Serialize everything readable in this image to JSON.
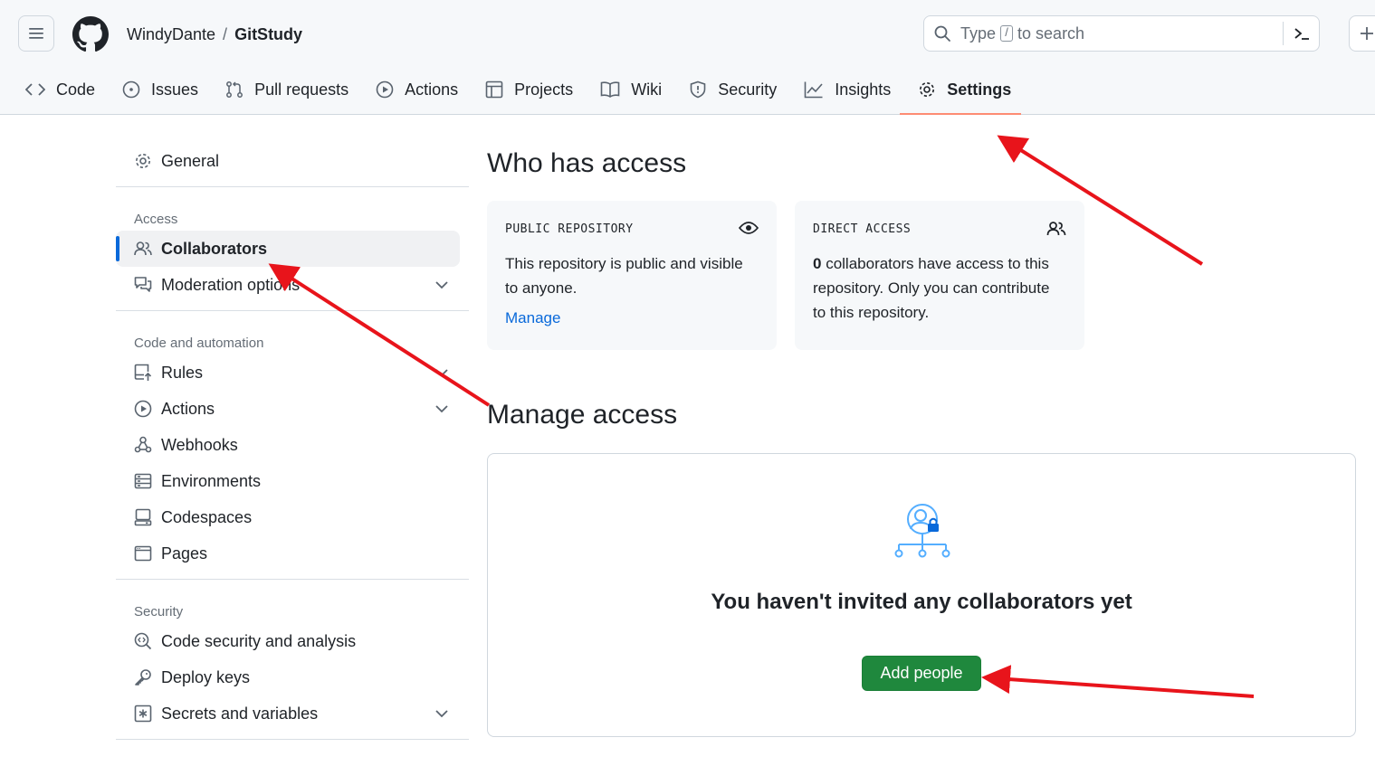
{
  "header": {
    "owner": "WindyDante",
    "separator": "/",
    "repo": "GitStudy",
    "search": {
      "prefix": "Type",
      "key": "/",
      "suffix": "to search"
    }
  },
  "tabs": [
    {
      "label": "Code",
      "icon": "code-icon"
    },
    {
      "label": "Issues",
      "icon": "issue-opened-icon"
    },
    {
      "label": "Pull requests",
      "icon": "git-pull-request-icon"
    },
    {
      "label": "Actions",
      "icon": "play-icon"
    },
    {
      "label": "Projects",
      "icon": "table-icon"
    },
    {
      "label": "Wiki",
      "icon": "book-icon"
    },
    {
      "label": "Security",
      "icon": "shield-icon"
    },
    {
      "label": "Insights",
      "icon": "graph-icon"
    },
    {
      "label": "Settings",
      "icon": "gear-icon",
      "active": true
    }
  ],
  "sidebar": {
    "general": "General",
    "access_heading": "Access",
    "access_items": [
      {
        "label": "Collaborators",
        "icon": "people-icon",
        "active": true
      },
      {
        "label": "Moderation options",
        "icon": "comment-discussion-icon",
        "expandable": true
      }
    ],
    "code_heading": "Code and automation",
    "code_items": [
      {
        "label": "Rules",
        "icon": "repo-push-icon",
        "expandable": true
      },
      {
        "label": "Actions",
        "icon": "play-icon",
        "expandable": true
      },
      {
        "label": "Webhooks",
        "icon": "webhook-icon"
      },
      {
        "label": "Environments",
        "icon": "server-icon"
      },
      {
        "label": "Codespaces",
        "icon": "codespaces-icon"
      },
      {
        "label": "Pages",
        "icon": "browser-icon"
      }
    ],
    "security_heading": "Security",
    "security_items": [
      {
        "label": "Code security and analysis",
        "icon": "codescan-icon"
      },
      {
        "label": "Deploy keys",
        "icon": "key-icon"
      },
      {
        "label": "Secrets and variables",
        "icon": "key-asterisk-icon",
        "expandable": true
      }
    ]
  },
  "main": {
    "title": "Who has access",
    "public_card": {
      "label": "PUBLIC REPOSITORY",
      "text": "This repository is public and visible to anyone.",
      "link": "Manage"
    },
    "direct_card": {
      "label": "DIRECT ACCESS",
      "count": "0",
      "text": " collaborators have access to this repository. Only you can contribute to this repository."
    },
    "manage_title": "Manage access",
    "empty_text": "You haven't invited any collaborators yet",
    "add_button": "Add people"
  },
  "colors": {
    "accent_link": "#0969da",
    "primary_button": "#1f883d",
    "tab_underline": "#fd8c73",
    "annotation_arrow": "#e8141b"
  }
}
